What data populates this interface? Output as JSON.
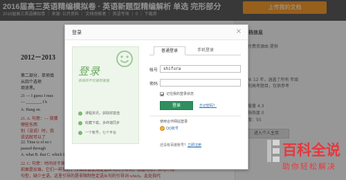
{
  "background": {
    "doc_title": "2016届高三英语精编模拟卷 · 英语新题型精编解析 单选 完形部分",
    "doc_meta": "2016届高三英语模拟卷 ｜ 来源: 公开资料 ｜ 文档贡献者 ｜ 英语专项 ｜ 0 ｜ 下载券",
    "upload_button": "上传我的文档",
    "doc_heading": "2012－2013",
    "doc_lines": [
      "第二部分．单项填",
      "从四个选项",
      "项涂黑。",
      "21 — I guess I mus",
      "— _______, I b",
      "A. Hang on",
      "21. A. 句意：— 我猜",
      "哪些东西",
      "别（没说）时，我",
      "说话就可以了",
      "22. Time is of no t",
      "passed through",
      "A. what    B. that    C. which D. where",
      "22. C. 句意：时间对于珠光们都是有意义的，它们今天和许多年前一样的美丽，因为他们的",
      "前面是珍珠，它们一样美好，所以应该使用定语从句的引导词，根据句意，从句不用",
      "句型，缺少主语，这里引导的是非限制性定语从句的引导词 which。此处指代 "
    ],
    "side_title": "文档信息",
    "side_lines": [
      "该付费资源由 提供",
      "",
      "自从 12 年，涵盖了所有 年级",
      "分和高考题目，仅供参考",
      "",
      "下载量    4.3",
      "文档热度    0",
      "热度：55"
    ],
    "side_button": "进入个人主页"
  },
  "dialog": {
    "title": "登录",
    "close_label": "×",
    "promo": {
      "brand": "登录",
      "slogan": "收获的不仅是财富值",
      "features": [
        "课程资讯，获取财富值",
        "收藏下载，多终端同步",
        "一个帐号，七个平台"
      ]
    },
    "tabs": [
      {
        "label": "普通登录"
      },
      {
        "label": "手机登录"
      }
    ],
    "username": {
      "label": "帐号",
      "value": "shifura"
    },
    "password": {
      "label": "密码",
      "value": ""
    },
    "remember": "记住我的登录状态",
    "login_button": "登录",
    "forgot_link": "忘记密码？",
    "partner_label": "使用合作网站登录",
    "qq_link": "QQ账号",
    "register_prompt": "还没有百度账号？",
    "register_link": "立即注册"
  },
  "watermark": {
    "big": "百科全说",
    "small": "助你轻松解决"
  },
  "colors": {
    "accent_green": "#2f8f5f",
    "promo_green": "#6aa95f",
    "upload_orange": "#f29a2e",
    "watermark_red": "#e8373d",
    "link_blue": "#2a6db0"
  }
}
